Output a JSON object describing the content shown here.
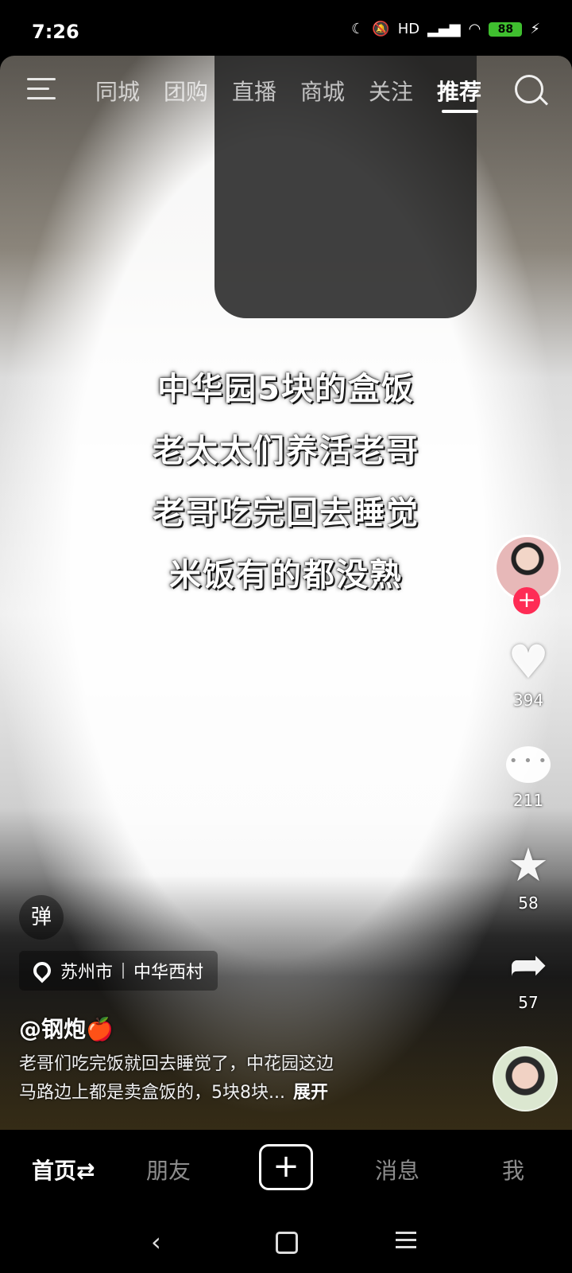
{
  "status_bar": {
    "time": "7:26",
    "signal_text": "HD",
    "battery": "88"
  },
  "top_nav": {
    "tabs": [
      "同城",
      "团购",
      "直播",
      "商城",
      "关注",
      "推荐"
    ],
    "active_tab": "推荐"
  },
  "video": {
    "caption_lines": [
      "中华园5块的盒饭",
      "老太太们养活老哥",
      "老哥吃完回去睡觉",
      "米饭有的都没熟"
    ]
  },
  "side_actions": {
    "follow_label": "+",
    "likes": "394",
    "comments": "211",
    "favorites": "58",
    "shares": "57"
  },
  "danmu_label": "弹",
  "location": {
    "city": "苏州市",
    "place": "中华西村"
  },
  "author": {
    "username": "@钢炮🍎"
  },
  "description": {
    "line1": "老哥们吃完饭就回去睡觉了，中花园这边",
    "line2": "马路边上都是卖盒饭的，5块8块...",
    "more": "展开"
  },
  "bottom_nav": {
    "home": "首页⇄",
    "friends": "朋友",
    "plus": "+",
    "messages": "消息",
    "me": "我"
  }
}
